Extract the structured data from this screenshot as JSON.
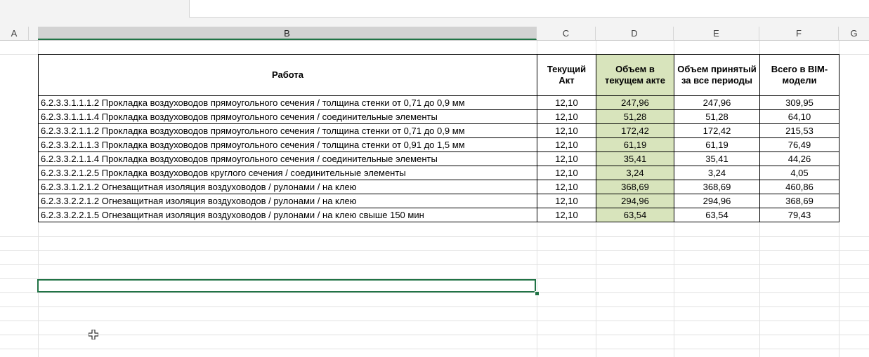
{
  "columns": [
    "A",
    "B",
    "C",
    "D",
    "E",
    "F",
    "G"
  ],
  "headers": {
    "work": "Работа",
    "current_act": "Текущий Акт",
    "volume_current_act": "Объем в текущем акте",
    "volume_accepted": "Объем принятый за все периоды",
    "total_bim": "Всего в BIM-модели"
  },
  "rows": [
    {
      "work": "6.2.3.3.1.1.1.2 Прокладка воздуховодов прямоугольного сечения / толщина стенки от 0,71 до 0,9 мм",
      "act": "12,10",
      "current": "247,96",
      "accepted": "247,96",
      "bim": "309,95"
    },
    {
      "work": "6.2.3.3.1.1.1.4 Прокладка воздуховодов прямоугольного сечения / соединительные элементы",
      "act": "12,10",
      "current": "51,28",
      "accepted": "51,28",
      "bim": "64,10"
    },
    {
      "work": "6.2.3.3.2.1.1.2 Прокладка воздуховодов прямоугольного сечения / толщина стенки от 0,71 до 0,9 мм",
      "act": "12,10",
      "current": "172,42",
      "accepted": "172,42",
      "bim": "215,53"
    },
    {
      "work": "6.2.3.3.2.1.1.3 Прокладка воздуховодов прямоугольного сечения / толщина стенки от 0,91 до 1,5 мм",
      "act": "12,10",
      "current": "61,19",
      "accepted": "61,19",
      "bim": "76,49"
    },
    {
      "work": "6.2.3.3.2.1.1.4 Прокладка воздуховодов прямоугольного сечения / соединительные элементы",
      "act": "12,10",
      "current": "35,41",
      "accepted": "35,41",
      "bim": "44,26"
    },
    {
      "work": "6.2.3.3.2.1.2.5 Прокладка воздуховодов круглого сечения / соединительные элементы",
      "act": "12,10",
      "current": "3,24",
      "accepted": "3,24",
      "bim": "4,05"
    },
    {
      "work": "6.2.3.3.1.2.1.2 Огнезащитная изоляция воздуховодов / рулонами / на клею",
      "act": "12,10",
      "current": "368,69",
      "accepted": "368,69",
      "bim": "460,86"
    },
    {
      "work": "6.2.3.3.2.2.1.2 Огнезащитная изоляция воздуховодов / рулонами / на клею",
      "act": "12,10",
      "current": "294,96",
      "accepted": "294,96",
      "bim": "368,69"
    },
    {
      "work": "6.2.3.3.2.2.1.5 Огнезащитная изоляция воздуховодов / рулонами / на клею свыше 150 мин",
      "act": "12,10",
      "current": "63,54",
      "accepted": "63,54",
      "bim": "79,43"
    }
  ],
  "colors": {
    "highlight": "#d8e4bc",
    "selection": "#217346"
  },
  "cursor_icon": "cell-cross-cursor-icon"
}
